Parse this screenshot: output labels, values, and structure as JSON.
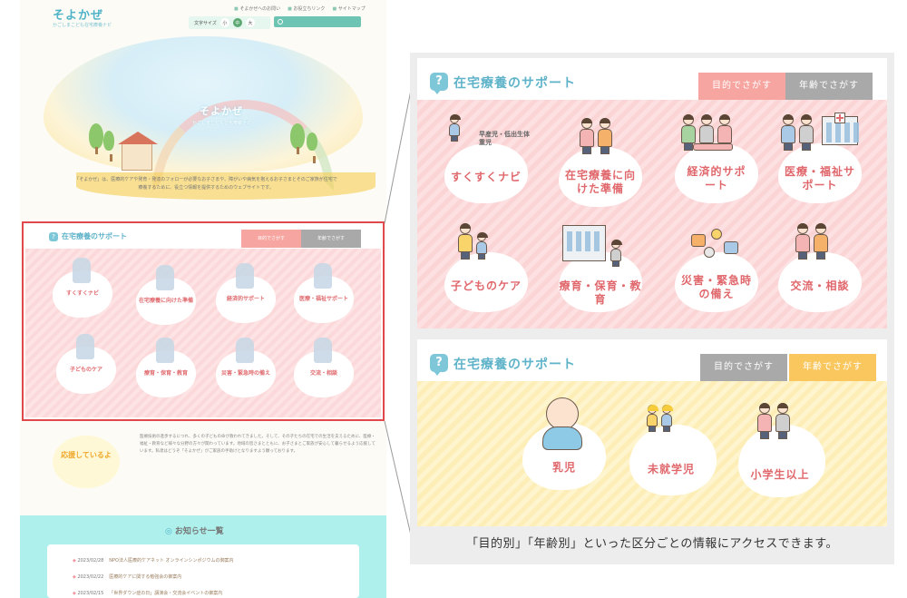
{
  "site": {
    "logo": "そよかぜ",
    "logo_sub": "かごしまこども在宅療養ナビ",
    "header_links": [
      "そよかぜへのお問い",
      "お役立ちリンク",
      "サイトマップ"
    ],
    "font_size_label": "文字サイズ",
    "font_sizes": [
      "小",
      "中",
      "大"
    ],
    "hero_title": "そよかぜ",
    "hero_sub": "かごしまこども在宅療養ナビ",
    "intro": "「そよかぜ」は、医療的ケアや発育・発達のフォローが必要なお子さまや、障がいや病気を抱えるお子さまとそのご家族が住宅で療養するために、役立つ情報を提供するためのウェブサイトです。"
  },
  "mini_panel": {
    "title": "在宅療養のサポート",
    "tab_purpose": "目的でさがす",
    "tab_age": "年齢でさがす",
    "items": [
      "すくすくナビ",
      "在宅療養に向けた準備",
      "経済的サポート",
      "医療・福祉サポート",
      "子どものケア",
      "療育・保育・教育",
      "災害・緊急時の備え",
      "交流・相談"
    ]
  },
  "support": {
    "badge": "応援しているよ",
    "text": "医療技術の進歩するにつれ、多くの子どもの命が救われてきました。そして、その子たちの在宅での生活を支えるために、医療・福祉・教育など様々な分野の方々が関わっています。地域の皆さまとともに、お子さまとご家族が安心して暮らせるよう応援しています。私達はどうぞ「そよかぜ」がご家族の手助けとなりますよう願っております。"
  },
  "news": {
    "title": "お知らせ一覧",
    "items": [
      {
        "date": "2023/02/28",
        "text": "NPO法人医療的ケアネット オンラインシンポジウムの御案内"
      },
      {
        "date": "2023/02/22",
        "text": "医療的ケアに関する勉強会の御案内"
      },
      {
        "date": "2023/02/15",
        "text": "「世界ダウン症の日」講演会・交流会イベントの御案内"
      }
    ]
  },
  "panel_purpose": {
    "title": "在宅療養のサポート",
    "tab_purpose": "目的でさがす",
    "tab_age": "年齢でさがす",
    "items": [
      {
        "small": "早産児・低出生体重児",
        "label": "すくすくナビ"
      },
      {
        "label": "在宅療養に向けた準備"
      },
      {
        "label": "経済的サポート"
      },
      {
        "label": "医療・福祉サポート"
      },
      {
        "label": "子どものケア"
      },
      {
        "label": "療育・保育・教育"
      },
      {
        "label": "災害・緊急時の備え"
      },
      {
        "label": "交流・相談"
      }
    ]
  },
  "panel_age": {
    "title": "在宅療養のサポート",
    "tab_purpose": "目的でさがす",
    "tab_age": "年齢でさがす",
    "items": [
      "乳児",
      "未就学児",
      "小学生以上"
    ]
  },
  "caption": "「目的別」「年齢別」といった区分ごとの情報にアクセスできます。",
  "colors": {
    "accent_blue": "#5fb3c9",
    "pink_tab": "#f7a5a0",
    "gray_tab": "#a9a9a9",
    "yellow_tab": "#f9c75e",
    "label_red": "#e0676c",
    "highlight_border": "#e0484b"
  }
}
